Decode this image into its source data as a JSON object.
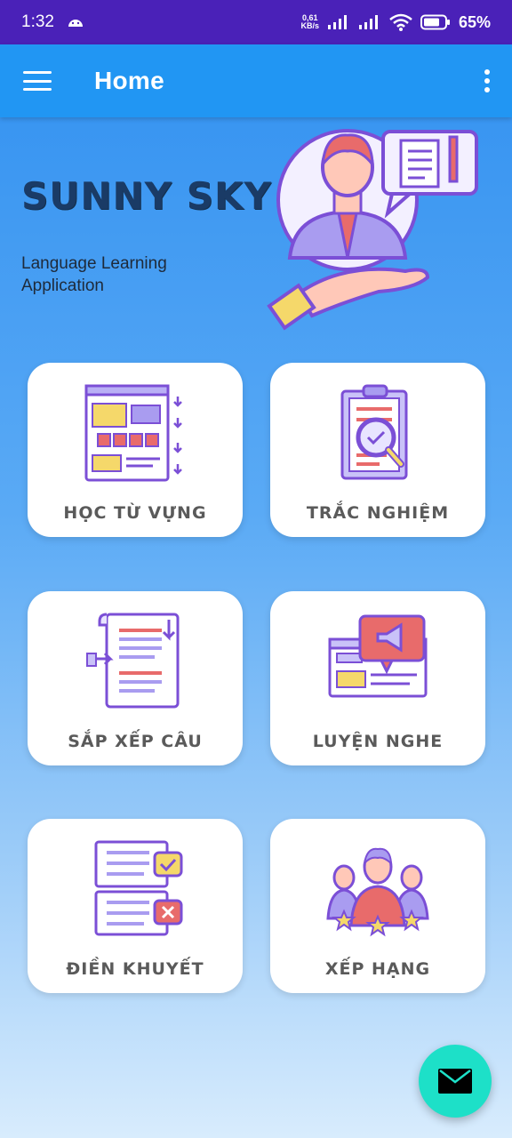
{
  "status_bar": {
    "time": "1:32",
    "net_speed_value": "0,61",
    "net_speed_unit": "KB/s",
    "battery": "65%"
  },
  "app_bar": {
    "title": "Home",
    "menu_icon": "hamburger-menu-icon",
    "more_icon": "more-vertical-icon"
  },
  "hero": {
    "title": "SUNNY SKY",
    "subtitle": "Language Learning Application"
  },
  "cards": [
    {
      "label": "HỌC TỪ VỰNG",
      "icon": "vocabulary-icon"
    },
    {
      "label": "TRẮC NGHIỆM",
      "icon": "quiz-icon"
    },
    {
      "label": "SẮP XẾP CÂU",
      "icon": "sentence-order-icon"
    },
    {
      "label": "LUYỆN NGHE",
      "icon": "listening-icon"
    },
    {
      "label": "ĐIỀN KHUYẾT",
      "icon": "fill-blank-icon"
    },
    {
      "label": "XẾP HẠNG",
      "icon": "ranking-icon"
    }
  ],
  "fab": {
    "icon": "mail-icon"
  },
  "colors": {
    "status_bar": "#4a21b8",
    "app_bar": "#2196f3",
    "fab": "#1de0c8",
    "hero_title": "#1a3b66"
  }
}
